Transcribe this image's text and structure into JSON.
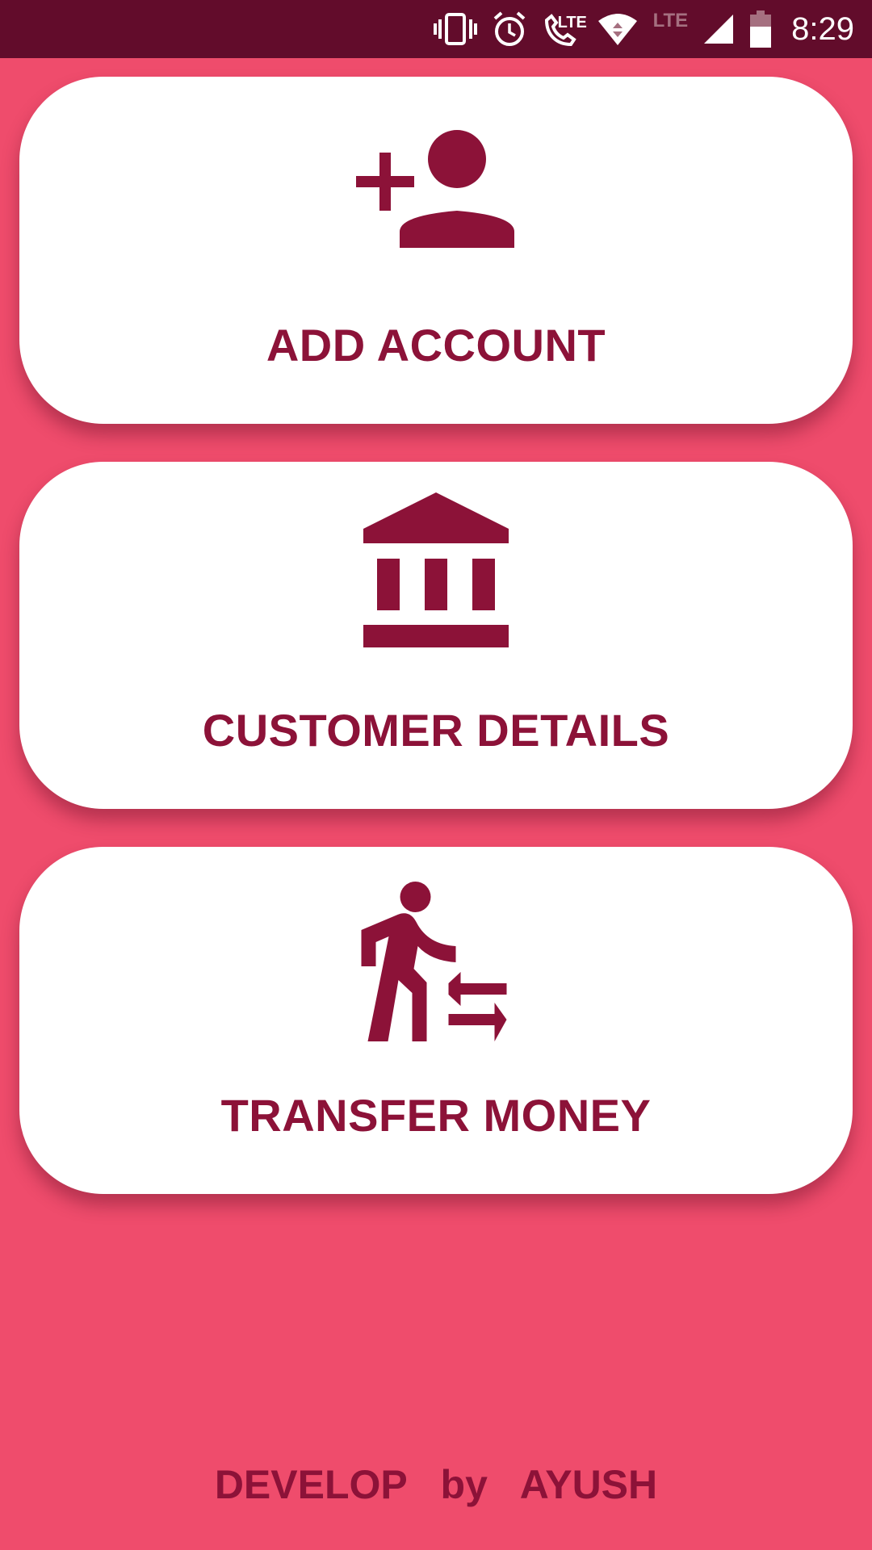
{
  "status_bar": {
    "time": "8:29",
    "lte_call_label": "LTE",
    "lte_signal_label": "LTE",
    "icons": [
      "vibrate-icon",
      "alarm-icon",
      "volte-call-icon",
      "wifi-icon",
      "signal-icon",
      "battery-icon"
    ]
  },
  "cards": [
    {
      "label": "ADD ACCOUNT",
      "icon": "add-person-icon"
    },
    {
      "label": "CUSTOMER DETAILS",
      "icon": "bank-icon"
    },
    {
      "label": "TRANSFER MONEY",
      "icon": "transfer-walk-icon"
    }
  ],
  "footer": {
    "text": "DEVELOP   by   AYUSH"
  },
  "colors": {
    "background": "#ef4c6c",
    "status_bar": "#620c2b",
    "accent": "#8c1238",
    "card": "#ffffff"
  }
}
